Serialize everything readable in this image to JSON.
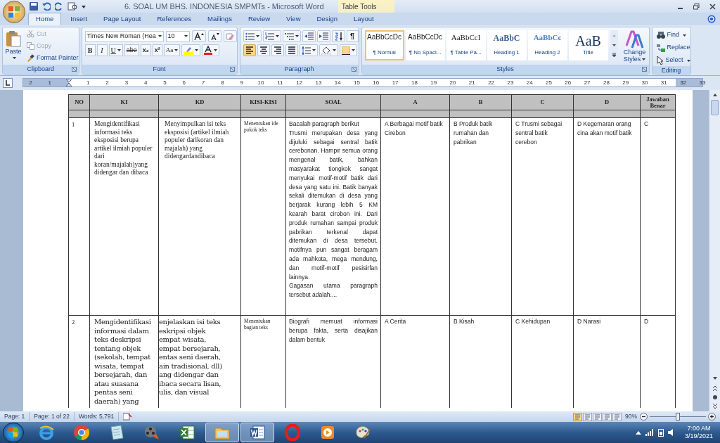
{
  "window": {
    "title": "6. SOAL UM BHS. INDONESIA SMPMTs - Microsoft Word",
    "context_tab": "Table Tools"
  },
  "ribbon_tabs": [
    {
      "label": "Home",
      "selected": true
    },
    {
      "label": "Insert",
      "selected": false
    },
    {
      "label": "Page Layout",
      "selected": false
    },
    {
      "label": "References",
      "selected": false
    },
    {
      "label": "Mailings",
      "selected": false
    },
    {
      "label": "Review",
      "selected": false
    },
    {
      "label": "View",
      "selected": false
    },
    {
      "label": "Design",
      "selected": false
    },
    {
      "label": "Layout",
      "selected": false
    }
  ],
  "clipboard": {
    "label": "Clipboard",
    "paste": "Paste",
    "items": [
      {
        "kind": "cut",
        "label": "Cut",
        "disabled": true
      },
      {
        "kind": "copy",
        "label": "Copy",
        "disabled": true
      },
      {
        "kind": "painter",
        "label": "Format Painter",
        "disabled": false
      }
    ]
  },
  "font": {
    "label": "Font",
    "name": "Times New Roman (Hea",
    "size": "10",
    "bold": "B",
    "italic": "I",
    "underline": "U",
    "strike": "abe",
    "subscript": "x₂",
    "superscript": "x²",
    "change_case": "Aa"
  },
  "paragraph": {
    "label": "Paragraph",
    "pilcrow": "¶",
    "align": [
      {
        "kind": "left",
        "selected": true
      },
      {
        "kind": "center",
        "selected": false
      },
      {
        "kind": "right",
        "selected": false
      },
      {
        "kind": "justify",
        "selected": false
      }
    ]
  },
  "styles": {
    "label": "Styles",
    "items": [
      {
        "kind": "normal",
        "preview": "AaBbCcDc",
        "name": "¶ Normal",
        "selected": true
      },
      {
        "kind": "normal",
        "preview": "AaBbCcDc",
        "name": "¶ No Spaci...",
        "selected": false
      },
      {
        "kind": "serif",
        "preview": "AaBbCcI",
        "name": "¶ Table Pa...",
        "selected": false
      },
      {
        "kind": "heading1",
        "preview": "AaBbC",
        "name": "Heading 1",
        "selected": false
      },
      {
        "kind": "heading2",
        "preview": "AaBbCc",
        "name": "Heading 2",
        "selected": false
      },
      {
        "kind": "title",
        "preview": "AaB",
        "name": "Title",
        "selected": false
      }
    ],
    "change_styles": "Change Styles"
  },
  "editing": {
    "label": "Editing",
    "items": [
      {
        "kind": "find",
        "label": "Find"
      },
      {
        "kind": "replace",
        "label": "Replace"
      },
      {
        "kind": "select",
        "label": "Select"
      }
    ]
  },
  "ruler": {
    "numbers": [
      "2",
      "1",
      "1",
      "2",
      "3",
      "4",
      "5",
      "6",
      "7",
      "8",
      "9",
      "10",
      "11",
      "12",
      "13",
      "14",
      "15",
      "16",
      "17",
      "18",
      "19",
      "20",
      "21",
      "22",
      "23",
      "24",
      "25",
      "26",
      "27",
      "28",
      "29",
      "30",
      "31",
      "32",
      "33"
    ]
  },
  "table": {
    "columns": [
      "NO",
      "KI",
      "KD",
      "KISI-KISI",
      "SOAL",
      "A",
      "B",
      "C",
      "D",
      "Jawaban Benar"
    ],
    "rows": [
      {
        "no": "1",
        "ki": "Mengidentifikasi informasi teks eksposisi berupa artikel ilmiah populer dari koran/majalah)yang didengar dan dibaca",
        "kd": "Menyimpulkan isi teks eksposisi (artikel ilmiah populer darikoran dan majalah) yang didengardandibaca",
        "kisi": "Menentukan ide pokok teks",
        "soal": "Bacalah paragraph berikut\nTrusmi merupakan desa yang dijuluki sebagai sentral batik cerebonan. Hampir semua orang mengenal batik, bahkan masyarakat tiongkok sangat menyukai motif-motif batik dari desa yang satu ini. Batik banyak sekali ditemukan di desa yang berjarak kurang lebih 5 KM kearah barat cirobon ini. Dari produk rumahan sampai produk pabrikan terkenal dapat ditemukan di desa tersebut. motifnya pun sangat beragam ada mahkota, mega mendung, dan motif-motif pesisirfan lainnya.\nGagasan utama paragraph tersebut adalah....",
        "a": "A Berbagai motif batik Cirebon",
        "b": "B Produk batik rumahan dan pabrikan",
        "c": "C Trusmi sebagai sentral batik cerebon",
        "d": "D Kegemaran orang cina akan motif batik",
        "answer": "C"
      },
      {
        "no": "2",
        "ki": "Mengidentifikasi informasi dalam teks deskripsi tentang objek (sekolah, tempat wisata, tempat bersejarah, dan atau suasana pentas seni daerah) yang",
        "kd": "enjelaskan isi teks\neskripsi objek\nempat wisata,\nempat bersejarah,\nentas seni daerah,\nain tradisional, dll)\nang didengar dan\nibaca secara lisan,\nulis, dan visual",
        "kisi": "Menentukan bagian teks",
        "soal": "Biografi memuat informasi berupa fakta, serta disajikan dalam bentuk",
        "a": "A Cerita",
        "b": "B Kisah",
        "c": "C Kehidupan",
        "d": "D Narasi",
        "answer": "D"
      }
    ]
  },
  "status_bar": {
    "page": "Page: 1",
    "pages": "Page: 1 of 22",
    "words": "Words: 5,791",
    "zoom": "90%",
    "zoom_slider": {
      "level": 0.5
    },
    "views": [
      {
        "selected": true
      },
      {
        "selected": false
      },
      {
        "selected": false
      },
      {
        "selected": false
      },
      {
        "selected": false
      }
    ]
  },
  "taskbar": {
    "apps": [
      {
        "kind": "ie",
        "active": false
      },
      {
        "kind": "chrome",
        "active": false
      },
      {
        "kind": "notes",
        "active": false
      },
      {
        "kind": "media",
        "active": false
      },
      {
        "kind": "excel",
        "active": false
      },
      {
        "kind": "explorer",
        "active": true
      },
      {
        "kind": "word",
        "active": true
      },
      {
        "kind": "opera",
        "active": false
      },
      {
        "kind": "player",
        "active": false
      },
      {
        "kind": "paint",
        "active": false
      }
    ],
    "time": "7:00 AM",
    "date": "3/19/2021"
  }
}
